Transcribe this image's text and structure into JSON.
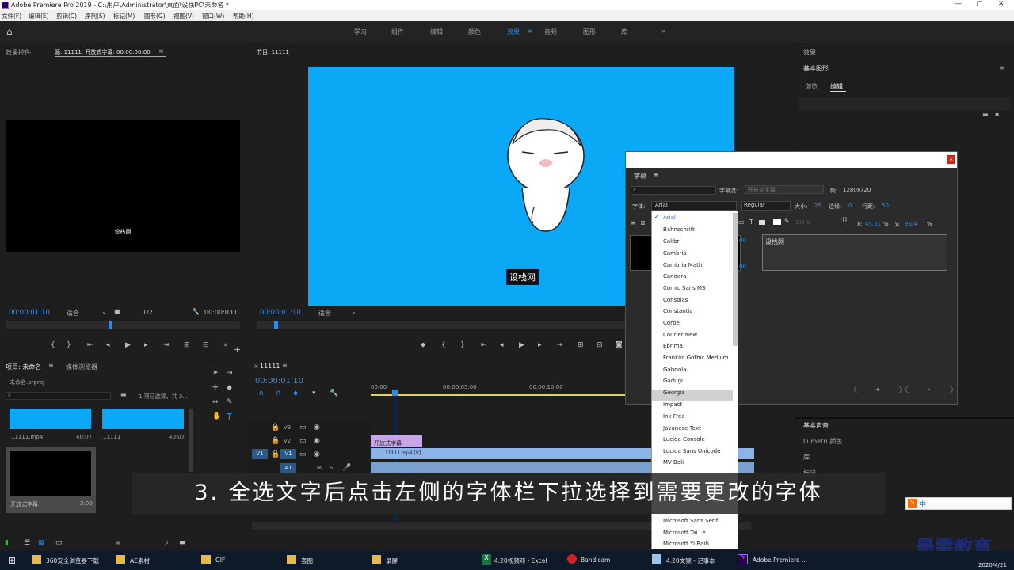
{
  "titlebar": {
    "title": "Adobe Premiere Pro 2019 - C:\\用户\\Administrator\\桌面\\设栈PC\\未命名 *",
    "min": "—",
    "max": "▢",
    "close": "✕"
  },
  "menubar": [
    "文件(F)",
    "编辑(E)",
    "剪辑(C)",
    "序列(S)",
    "标记(M)",
    "图形(G)",
    "视图(V)",
    "窗口(W)",
    "帮助(H)"
  ],
  "workspace": {
    "tabs": [
      "学习",
      "组件",
      "编辑",
      "颜色",
      "效果",
      "音频",
      "图形",
      "库"
    ],
    "active": "效果",
    "more": "»"
  },
  "source_panel": {
    "tab1": "效果控件",
    "tab2": "源: 11111: 开放式字幕: 00:00:00:00",
    "preview_text": "设栈网",
    "timecode": "00:00:01:10",
    "fit": "适合",
    "quality": "1/2",
    "duration": "00:00:03:0"
  },
  "program_panel": {
    "tab": "节目: 11111",
    "caption_text": "设栈网",
    "timecode": "00:00:01:10",
    "fit": "适合"
  },
  "right_panel": {
    "tab": "效果",
    "subtitle": "基本图形",
    "browse": "浏览",
    "edit": "编辑",
    "basic_sound": "基本声音",
    "lumetri": "Lumetri 颜色",
    "library": "库",
    "markers": "标记"
  },
  "project_panel": {
    "tab1": "项目: 未命名",
    "tab2": "媒体浏览器",
    "file": "未命名.prproj",
    "selection": "1 项已选择，共 3...",
    "items": [
      {
        "name": "11111.mp4",
        "dur": "40:07"
      },
      {
        "name": "11111",
        "dur": "40:07"
      },
      {
        "name": "开放式字幕",
        "dur": "3:00"
      }
    ]
  },
  "timeline": {
    "tab": "11111",
    "timecode": "00:00:01:10",
    "ruler": [
      "00:00",
      "00:00:05:00",
      "00:00:10:00"
    ],
    "tracks": [
      "V3",
      "V2",
      "V1",
      "A1"
    ],
    "v1_source": "V1",
    "a1_source": "A1",
    "clip_v1": "11111.mp4 [V]",
    "clip_v2": "开放式字幕"
  },
  "dialog": {
    "title": "字幕",
    "caption_stream_label": "字幕流:",
    "caption_stream_value": "开放式字幕",
    "frame_label": "帧:",
    "frame_value": "1280x720",
    "font_label": "字体:",
    "font_value": "Arial",
    "style_value": "Regular",
    "size_label": "大小:",
    "size_value": "25",
    "edge_label": "边缘:",
    "edge_value": "0",
    "line_label": "行距:",
    "line_value": "50",
    "opacity": "100 %",
    "x_label": "x:",
    "x_value": "45.51",
    "y_label": "y:",
    "y_value": "93.4",
    "percent": "%",
    "text_content": "设栈网",
    "add_button": "+",
    "remove_button": "-",
    "num_a": "00",
    "num_b": "00"
  },
  "fontlist": [
    "Arial",
    "Bahnschrift",
    "Calibri",
    "Cambria",
    "Cambria Math",
    "Candara",
    "Comic Sans MS",
    "Consolas",
    "Constantia",
    "Corbel",
    "Courier New",
    "Ebrima",
    "Franklin Gothic Medium",
    "Gabriola",
    "Gadugi",
    "Georgia",
    "Impact",
    "Ink Free",
    "Javanese Text",
    "Lucida Console",
    "Lucida Sans Unicode",
    "MV Boli"
  ],
  "fontlist_bottom": [
    "Microsoft Sans Serif",
    "Microsoft Tai Le",
    "Microsoft Yi Baiti"
  ],
  "fontlist_selected": "Arial",
  "fontlist_hover": "Georgia",
  "caption_overlay": "3. 全选文字后点击左侧的字体栏下拉选择到需要更改的字体",
  "ime": "中",
  "watermark": "最需教育",
  "taskbar": {
    "items": [
      "360安全浏览器下载",
      "AE素材",
      "GIF",
      "套图",
      "录屏",
      "4.20视频邓 - Excel",
      "Bandicam",
      "4.20文案 - 记事本",
      "Adobe Premiere ..."
    ],
    "date": "2020/4/21"
  },
  "colors": {
    "accent": "#2d8ceb",
    "program_bg": "#0aa8f5",
    "clip": "#8cb4e8"
  }
}
